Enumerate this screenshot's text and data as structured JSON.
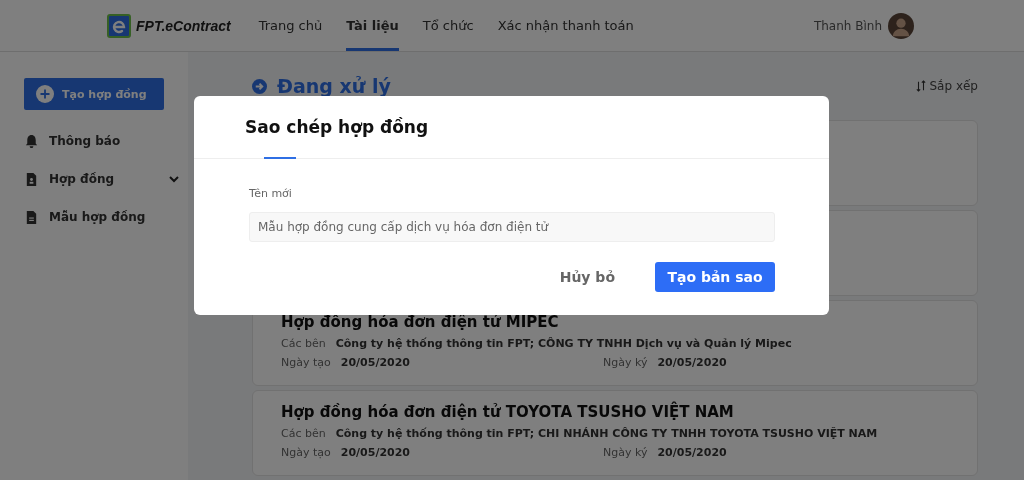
{
  "header": {
    "brand": "FPT.eContract",
    "nav": [
      {
        "label": "Trang chủ",
        "selected": false
      },
      {
        "label": "Tài liệu",
        "selected": true
      },
      {
        "label": "Tổ chức",
        "selected": false
      },
      {
        "label": "Xác nhận thanh toán",
        "selected": false
      }
    ],
    "user": "Thanh Bình"
  },
  "sidebar": {
    "create_button": "Tạo hợp đồng",
    "items": [
      {
        "kind": "bell",
        "label": "Thông báo"
      },
      {
        "kind": "document",
        "label": "Hợp đồng",
        "expanded": false
      },
      {
        "kind": "template",
        "label": "Mẫu hợp đồng"
      }
    ]
  },
  "main": {
    "title": "Đang xử lý",
    "sort": "Sắp xếp",
    "cards": [
      {
        "title": "Hợp đồng hóa đơn điện tử MIPEC",
        "parties_label": "Các bên",
        "parties": "Công ty hệ thống thông tin FPT; CÔNG TY TNHH Dịch vụ và Quản lý Mipec",
        "created_label": "Ngày tạo",
        "created": "20/05/2020",
        "signed_label": "Ngày ký",
        "signed": "20/05/2020"
      },
      {
        "title": "Hợp đồng hóa đơn điện tử TOYOTA TSUSHO VIỆT NAM",
        "parties_label": "Các bên",
        "parties": "Công ty hệ thống thông tin FPT; CHI NHÁNH CÔNG TY TNHH TOYOTA TSUSHO VIỆT NAM",
        "created_label": "Ngày tạo",
        "created": "20/05/2020",
        "signed_label": "Ngày ký",
        "signed": "20/05/2020"
      }
    ]
  },
  "dialog": {
    "title": "Sao chép hợp đồng",
    "field_label": "Tên mới",
    "field_value": "Mẫu hợp đồng cung cấp dịch vụ hóa đơn điện tử",
    "cancel": "Hủy bỏ",
    "confirm": "Tạo bản sao"
  }
}
